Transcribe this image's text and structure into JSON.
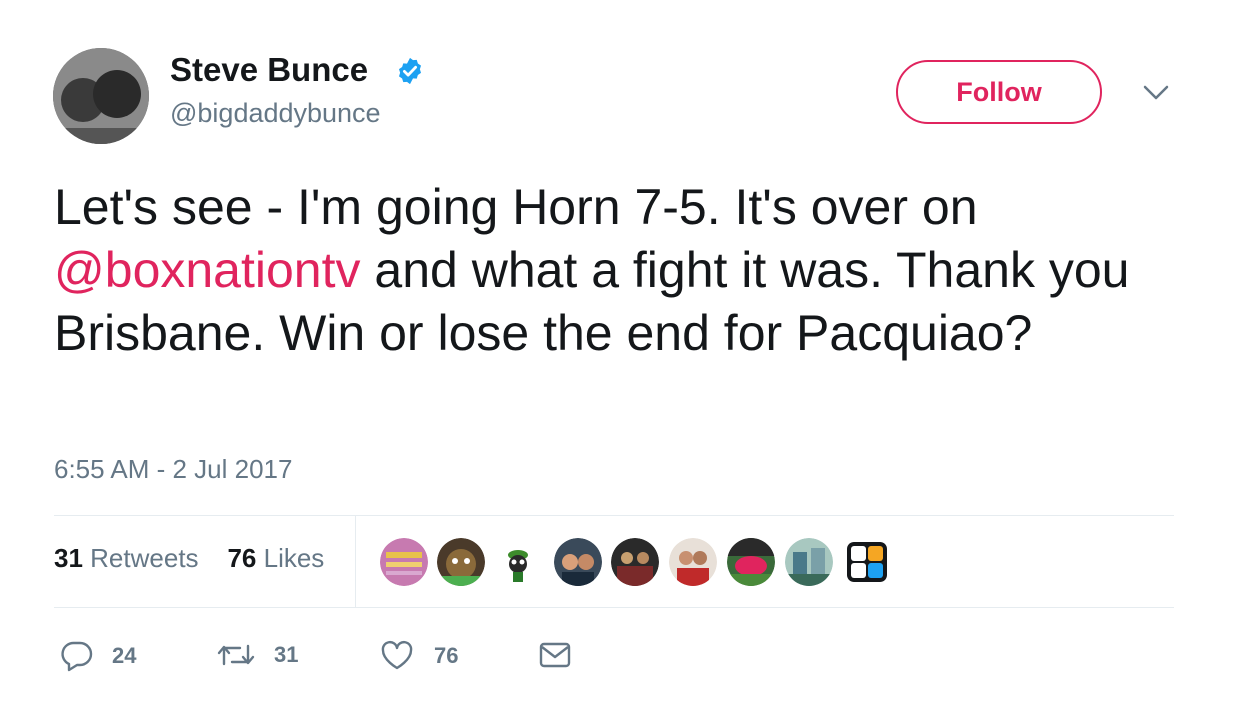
{
  "user": {
    "name": "Steve Bunce",
    "handle": "@bigdaddybunce",
    "verified": true
  },
  "follow_label": "Follow",
  "tweet": {
    "text_before": "Let's see - I'm going Horn 7-5. It's over on ",
    "mention": "@boxnationtv",
    "text_after": " and what a fight it was. Thank you Brisbane. Win or lose the end for Pacquiao?",
    "timestamp": "6:55 AM - 2 Jul 2017"
  },
  "stats": {
    "retweets_count": "31",
    "retweets_label": "Retweets",
    "likes_count": "76",
    "likes_label": "Likes"
  },
  "actions": {
    "replies": "24",
    "retweets": "31",
    "likes": "76"
  },
  "colors": {
    "accent": "#e0245e",
    "verified": "#1da1f2",
    "muted": "#657786",
    "text": "#14171a"
  }
}
